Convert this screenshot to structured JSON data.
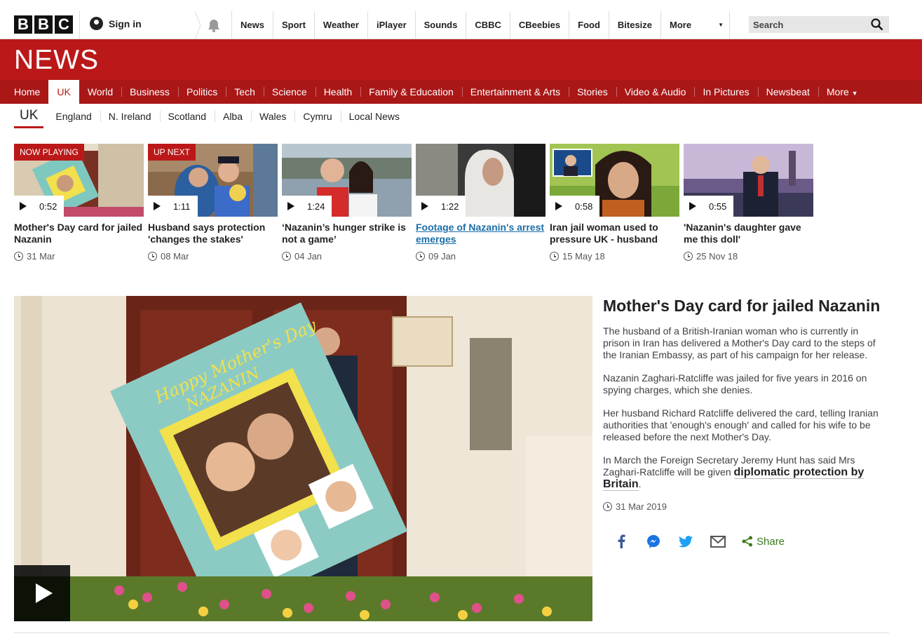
{
  "header": {
    "logo_letters": [
      "B",
      "B",
      "C"
    ],
    "signin_label": "Sign in",
    "nav_items": [
      "News",
      "Sport",
      "Weather",
      "iPlayer",
      "Sounds",
      "CBBC",
      "CBeebies",
      "Food",
      "Bitesize"
    ],
    "more_label": "More",
    "search_placeholder": "Search"
  },
  "banner": {
    "brand": "NEWS"
  },
  "section_nav": {
    "items": [
      "Home",
      "UK",
      "World",
      "Business",
      "Politics",
      "Tech",
      "Science",
      "Health",
      "Family & Education",
      "Entertainment & Arts",
      "Stories",
      "Video & Audio",
      "In Pictures",
      "Newsbeat"
    ],
    "active": "UK",
    "more_label": "More"
  },
  "sub_nav": {
    "current": "UK",
    "items": [
      "England",
      "N. Ireland",
      "Scotland",
      "Alba",
      "Wales",
      "Cymru",
      "Local News"
    ]
  },
  "videos": [
    {
      "label": "NOW PLAYING",
      "duration": "0:52",
      "title": "Mother's Day card for jailed Nazanin",
      "date": "31 Mar",
      "is_link": false
    },
    {
      "label": "UP NEXT",
      "duration": "1:11",
      "title": "Husband says protection 'changes the stakes'",
      "date": "08 Mar",
      "is_link": false
    },
    {
      "label": "",
      "duration": "1:24",
      "title": "‘Nazanin’s hunger strike is not a game’",
      "date": "04 Jan",
      "is_link": false
    },
    {
      "label": "",
      "duration": "1:22",
      "title": "Footage of Nazanin's arrest emerges",
      "date": "09 Jan",
      "is_link": true
    },
    {
      "label": "",
      "duration": "0:58",
      "title": "Iran jail woman used to pressure UK - husband",
      "date": "15 May 18",
      "is_link": false
    },
    {
      "label": "",
      "duration": "0:55",
      "title": "'Nazanin's daughter gave me this doll'",
      "date": "25 Nov 18",
      "is_link": false
    }
  ],
  "feature": {
    "poster_text_line1": "Happy Mother's Day",
    "poster_text_line2": "NAZANIN"
  },
  "article": {
    "title": "Mother's Day card for jailed Nazanin",
    "para1": "The husband of a British-Iranian woman who is currently in prison in Iran has delivered a Mother's Day card to the steps of the Iranian Embassy, as part of his campaign for her release.",
    "para2": "Nazanin Zaghari-Ratcliffe was jailed for five years in 2016 on spying charges, which she denies.",
    "para3": "Her husband Richard Ratcliffe delivered the card, telling Iranian authorities that 'enough's enough' and called for his wife to be released before the next Mother's Day.",
    "para4_prefix": "In March the Foreign Secretary Jeremy Hunt has said Mrs Zaghari-Ratcliffe will be given ",
    "para4_link": "diplomatic protection by Britain",
    "para4_suffix": ".",
    "date": "31 Mar 2019",
    "share_label": "Share"
  },
  "colors": {
    "brand_red": "#bb1919",
    "nav_red": "#a91717",
    "share_green": "#3a7a1c",
    "link_blue": "#1a6ea8"
  }
}
